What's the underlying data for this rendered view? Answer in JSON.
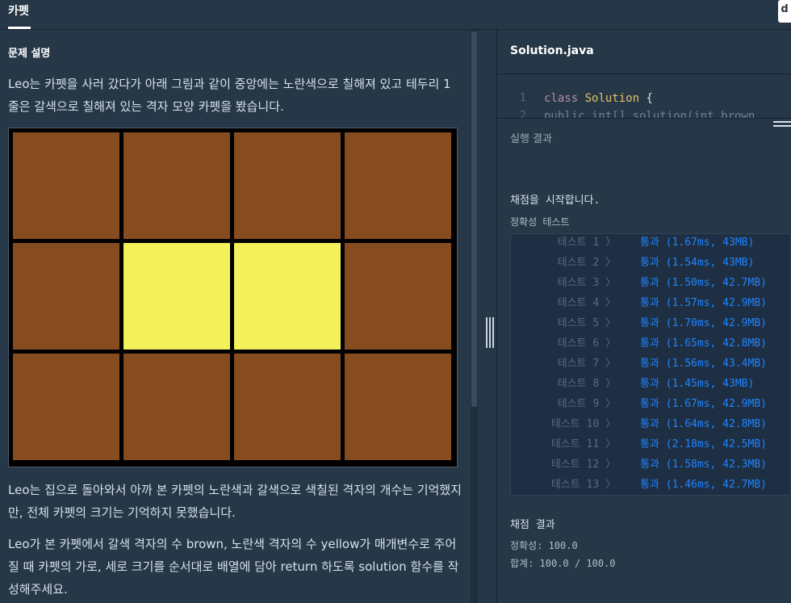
{
  "tab": {
    "title": "카펫",
    "corner_label": "d"
  },
  "problem": {
    "section_title": "문제 설명",
    "p1": "Leo는 카펫을 사러 갔다가 아래 그림과 같이 중앙에는 노란색으로 칠해져 있고 테두리 1줄은 갈색으로 칠해져 있는 격자 모양 카펫을 봤습니다.",
    "p2": "Leo는 집으로 돌아와서 아까 본 카펫의 노란색과 갈색으로 색칠된 격자의 개수는 기억했지만, 전체 카펫의 크기는 기억하지 못했습니다.",
    "p3": "Leo가 본 카펫에서 갈색 격자의 수 brown, 노란색 격자의 수 yellow가 매개변수로 주어질 때 카펫의 가로, 세로 크기를 순서대로 배열에 담아 return 하도록 solution 함수를 작성해주세요."
  },
  "carpet": {
    "columns": 4,
    "rows": 3,
    "brown_color": "#874b20",
    "yellow_color": "#f3f159",
    "yellow_cells": [
      [
        1,
        1
      ],
      [
        1,
        2
      ]
    ]
  },
  "editor": {
    "file_name": "Solution.java",
    "line1_num": "1",
    "line1_kw": "class",
    "line1_cls": "Solution",
    "line1_rest": " {",
    "line2_num": "2",
    "line2_text": "    public int[] solution(int brown"
  },
  "result": {
    "header": "실행 결과",
    "start_msg": "채점을 시작합니다.",
    "accuracy_label": "정확성  테스트",
    "tests": [
      {
        "name": "테스트 1 〉",
        "result": "통과 (1.67ms, 43MB)"
      },
      {
        "name": "테스트 2 〉",
        "result": "통과 (1.54ms, 43MB)"
      },
      {
        "name": "테스트 3 〉",
        "result": "통과 (1.50ms, 42.7MB)"
      },
      {
        "name": "테스트 4 〉",
        "result": "통과 (1.57ms, 42.9MB)"
      },
      {
        "name": "테스트 5 〉",
        "result": "통과 (1.70ms, 42.9MB)"
      },
      {
        "name": "테스트 6 〉",
        "result": "통과 (1.65ms, 42.8MB)"
      },
      {
        "name": "테스트 7 〉",
        "result": "통과 (1.56ms, 43.4MB)"
      },
      {
        "name": "테스트 8 〉",
        "result": "통과 (1.45ms, 43MB)"
      },
      {
        "name": "테스트 9 〉",
        "result": "통과 (1.67ms, 42.9MB)"
      },
      {
        "name": "테스트 10 〉",
        "result": "통과 (1.64ms, 42.8MB)"
      },
      {
        "name": "테스트 11 〉",
        "result": "통과 (2.18ms, 42.5MB)"
      },
      {
        "name": "테스트 12 〉",
        "result": "통과 (1.58ms, 42.3MB)"
      },
      {
        "name": "테스트 13 〉",
        "result": "통과 (1.46ms, 42.7MB)"
      }
    ],
    "final_title": "채점 결과",
    "final_accuracy": "정확성: 100.0",
    "final_total": "합계: 100.0 / 100.0"
  }
}
